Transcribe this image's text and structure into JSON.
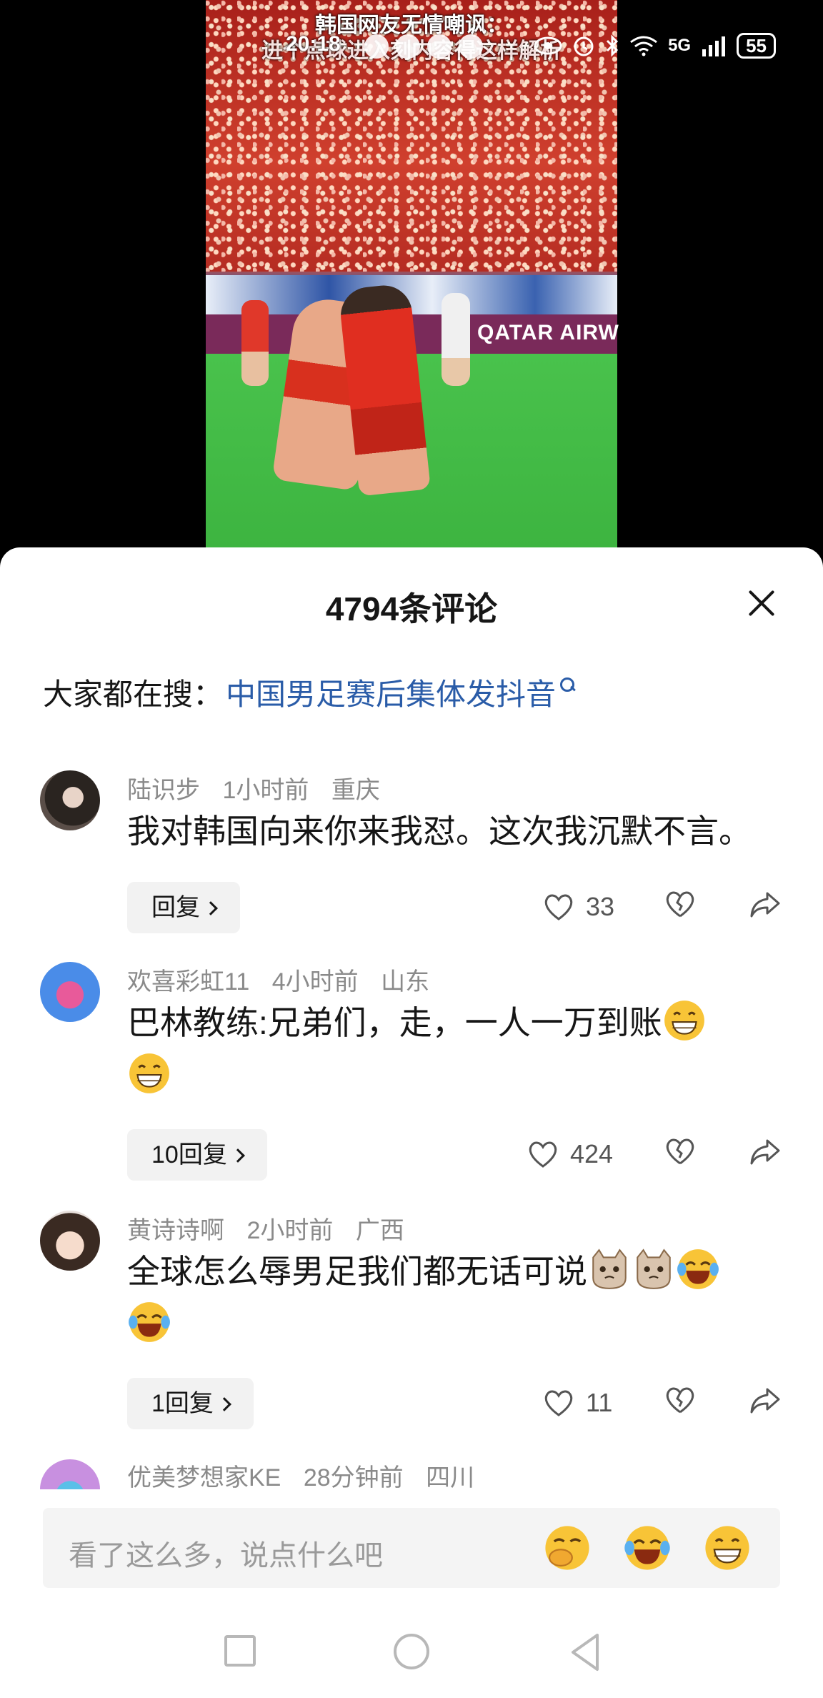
{
  "status_bar": {
    "time": "20:18",
    "network": "5G",
    "battery": "55"
  },
  "video": {
    "caption_line1": "韩国网友无情嘲讽：",
    "caption_line2": "进个点球进入刻内容得这样解析",
    "ad_text": "QATAR AIRW"
  },
  "comments_sheet": {
    "title": "4794条评论",
    "hot_search_label": "大家都在搜：",
    "hot_search_term": "中国男足赛后集体发抖音"
  },
  "comments": [
    {
      "username": "陆识步",
      "time": "1小时前",
      "location": "重庆",
      "text": "我对韩国向来你来我怼。这次我沉默不言。",
      "reply_label": "回复",
      "likes": "33"
    },
    {
      "username": "欢喜彩虹11",
      "time": "4小时前",
      "location": "山东",
      "text": "巴林教练:兄弟们，走，一人一万到账",
      "reply_label": "10回复",
      "likes": "424"
    },
    {
      "username": "黄诗诗啊",
      "time": "2小时前",
      "location": "广西",
      "text": "全球怎么辱男足我们都无话可说",
      "reply_label": "1回复",
      "likes": "11"
    },
    {
      "username": "优美梦想家KE",
      "time": "28分钟前",
      "location": "四川"
    }
  ],
  "input": {
    "placeholder": "看了这么多，说点什么吧"
  },
  "icons": {
    "like": "heart-icon",
    "dislike": "broken-heart-icon",
    "share": "share-arrow-icon",
    "close": "close-icon"
  },
  "colors": {
    "link": "#2a5ca8",
    "meta": "#8a8a8a",
    "text": "#161616"
  }
}
